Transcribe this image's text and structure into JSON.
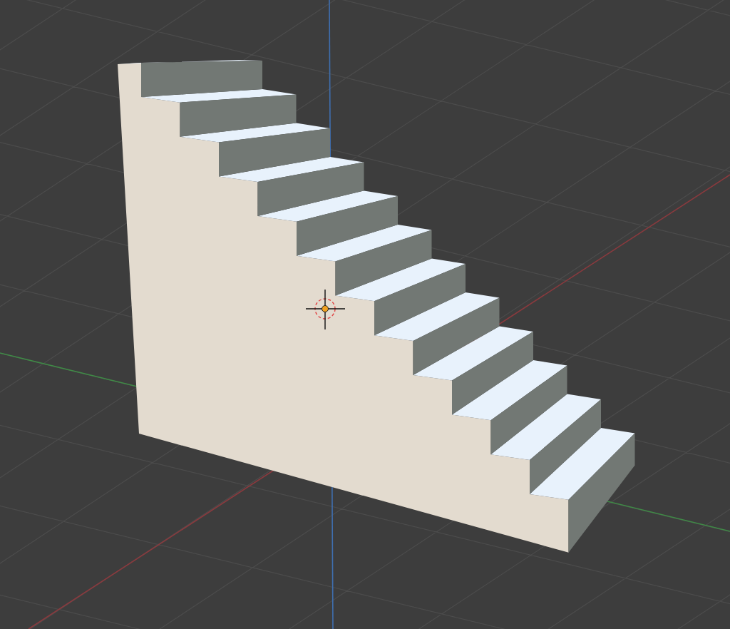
{
  "viewport": {
    "grid": {
      "visible": true
    },
    "axes": {
      "visible": true
    },
    "cursor": {
      "visible": true
    },
    "objects": [
      {
        "kind": "staircase",
        "selected": false
      }
    ]
  }
}
